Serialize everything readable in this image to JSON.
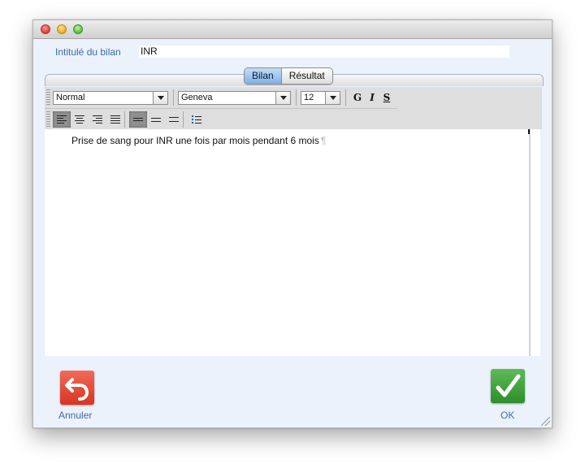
{
  "form": {
    "bilan_label": "Intitulé du bilan",
    "bilan_value": "INR"
  },
  "tabs": [
    {
      "label": "Bilan",
      "active": true
    },
    {
      "label": "Résultat",
      "active": false
    }
  ],
  "toolbar": {
    "style_value": "Normal",
    "font_value": "Geneva",
    "size_value": "12",
    "bold_label": "G",
    "italic_label": "I",
    "strike_label": "S",
    "alignment_selected": "left",
    "spacing_selected": "single"
  },
  "editor": {
    "text": "Prise de sang pour INR une fois par mois pendant 6 mois",
    "pilcrow": "¶"
  },
  "actions": {
    "cancel_label": "Annuler",
    "ok_label": "OK"
  },
  "colors": {
    "label_blue": "#3f6aa8",
    "cancel_red": "#e2483a",
    "ok_green": "#3fa13c",
    "window_bg": "#ebf2fb"
  },
  "icons": {
    "cancel": "undo-arrow-icon",
    "ok": "checkmark-icon"
  }
}
